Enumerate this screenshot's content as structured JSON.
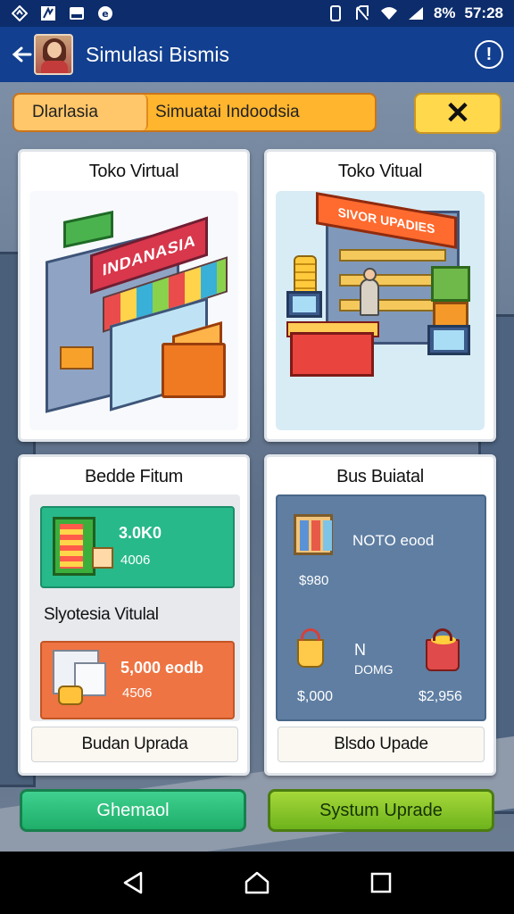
{
  "status_bar": {
    "battery": "8%",
    "time": "57:28",
    "icons": [
      "navigation-icon",
      "notes-icon",
      "mail-icon",
      "whatsapp-icon",
      "vibrate-icon",
      "no-sim-icon",
      "wifi-icon",
      "signal-icon"
    ]
  },
  "app_bar": {
    "title": "Simulasi Bismis",
    "info_label": "!"
  },
  "tabs": {
    "tab1": "Dlarlasia",
    "tab2": "Simuatai Indoodsia",
    "tool_symbol": "✕"
  },
  "cards": {
    "store1": {
      "title": "Toko Virtual",
      "sign": "INDANASIA"
    },
    "store2": {
      "title": "Toko Vitual",
      "sign": "SIVOR UPADIES"
    },
    "left_panel": {
      "title": "Bedde Fitum",
      "item1_value": "3.0K0",
      "item1_sub": "4006",
      "section": "Slyotesia Vitulal",
      "item2_value": "5,000 eodb",
      "item2_sub": "4506",
      "button": "Budan Uprada"
    },
    "right_panel": {
      "title": "Bus Buiatal",
      "item1_value": "NOTO eood",
      "price1": "$980",
      "item2_label": "N",
      "item2_sub": "DOMG",
      "price2": "$,000",
      "price3": "$2,956",
      "button": "Blsdo Upade"
    }
  },
  "buttons": {
    "left": "Ghemaol",
    "right": "Systum Uprade"
  },
  "nav": {
    "back": "back-icon",
    "home": "home-icon",
    "recents": "recents-icon"
  }
}
